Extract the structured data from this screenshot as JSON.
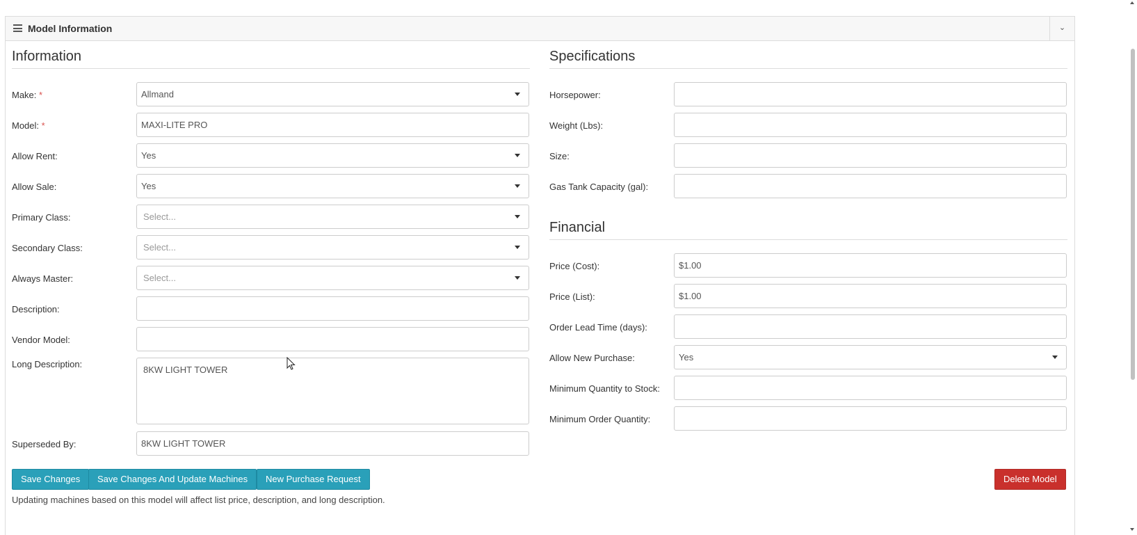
{
  "panel": {
    "title": "Model Information",
    "collapse_icon": "⌄"
  },
  "information": {
    "heading": "Information",
    "make": {
      "label": "Make:",
      "required": "*",
      "value": "Allmand"
    },
    "model": {
      "label": "Model:",
      "required": "*",
      "value": "MAXI-LITE PRO"
    },
    "allow_rent": {
      "label": "Allow Rent:",
      "value": "Yes"
    },
    "allow_sale": {
      "label": "Allow Sale:",
      "value": "Yes"
    },
    "primary_class": {
      "label": "Primary Class:",
      "placeholder": "Select..."
    },
    "secondary_class": {
      "label": "Secondary Class:",
      "placeholder": "Select..."
    },
    "always_master": {
      "label": "Always Master:",
      "placeholder": "Select..."
    },
    "description": {
      "label": "Description:",
      "value": ""
    },
    "vendor_model": {
      "label": "Vendor Model:",
      "value": ""
    },
    "long_description": {
      "label": "Long Description:",
      "value": "8KW LIGHT TOWER"
    },
    "superseded_by": {
      "label": "Superseded By:",
      "value": "8KW LIGHT TOWER"
    }
  },
  "specifications": {
    "heading": "Specifications",
    "horsepower": {
      "label": "Horsepower:",
      "value": ""
    },
    "weight": {
      "label": "Weight (Lbs):",
      "value": ""
    },
    "size": {
      "label": "Size:",
      "value": ""
    },
    "gas_tank": {
      "label": "Gas Tank Capacity (gal):",
      "value": ""
    }
  },
  "financial": {
    "heading": "Financial",
    "price_cost": {
      "label": "Price (Cost):",
      "value": "$1.00"
    },
    "price_list": {
      "label": "Price (List):",
      "value": "$1.00"
    },
    "lead_time": {
      "label": "Order Lead Time (days):",
      "value": ""
    },
    "allow_new_purchase": {
      "label": "Allow New Purchase:",
      "value": "Yes"
    },
    "min_qty_stock": {
      "label": "Minimum Quantity to Stock:",
      "value": ""
    },
    "min_order_qty": {
      "label": "Minimum Order Quantity:",
      "value": ""
    }
  },
  "actions": {
    "save": "Save Changes",
    "save_update": "Save Changes And Update Machines",
    "new_purchase": "New Purchase Request",
    "delete": "Delete Model"
  },
  "footer_note": "Updating machines based on this model will affect list price, description, and long description.",
  "colors": {
    "primary_button": "#2aa0b9",
    "danger_button": "#c9302c",
    "required": "#d9534f"
  },
  "icons": {
    "menu": "hamburger-icon",
    "collapse": "chevron-down-icon",
    "dropdown": "caret-down-icon"
  }
}
